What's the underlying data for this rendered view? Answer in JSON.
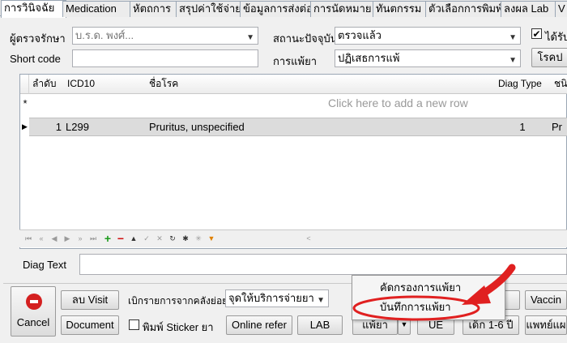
{
  "tabs": [
    "การวินิจฉัย",
    "Medication",
    "หัตถการ",
    "สรุปค่าใช้จ่าย",
    "ข้อมูลการส่งต่อ",
    "การนัดหมาย",
    "ทันตกรรม",
    "ตัวเลือกการพิมพ์",
    "ลงผล Lab",
    "V"
  ],
  "form": {
    "examiner_label": "ผู้ตรวจรักษา",
    "examiner_value": "บ.ร.ด. พงศ์...",
    "status_label": "สถานะปัจจุบัน",
    "status_value": "ตรวจแล้ว",
    "checkbox_label": "ได้รับ",
    "shortcode_label": "Short code",
    "allergy_label": "การแพ้ยา",
    "allergy_value": "ปฏิเสธการแพ้",
    "right_button": "โรคป"
  },
  "grid": {
    "columns": [
      "ลำดับ",
      "ICD10",
      "ชื่อโรค",
      "Diag Type",
      "ชนิ"
    ],
    "new_row_marker": "*",
    "new_row_hint": "Click here to add a new row",
    "rows": [
      {
        "marker": "▶",
        "no": "1",
        "icd10": "L299",
        "name": "Pruritus, unspecified",
        "type": "1",
        "extra": "Pr"
      }
    ]
  },
  "navigator": [
    "first",
    "prev-page",
    "prev",
    "next",
    "next-page",
    "last",
    "add",
    "remove",
    "up",
    "check",
    "cancel",
    "refresh",
    "star",
    "star-new",
    "filter"
  ],
  "diag_text_label": "Diag Text",
  "bottom": {
    "cancel_label": "Cancel",
    "delete_visit": "ลบ Visit",
    "document": "Document",
    "open_list_label": "เบิกรายการจากคลังย่อย",
    "dispense_value": "จุดให้บริการจ่ายยา",
    "print_sticker": "พิมพ์ Sticker ยา",
    "online_refer": "Online refer",
    "lab": "LAB",
    "allergy_button": "แพ้ยา",
    "ue": "UE",
    "child": "เด็ก 1-6 ปี",
    "vaccine": "Vaccin",
    "doctor": "แพทย์แผ"
  },
  "menu": {
    "items": [
      "คัดกรองการแพ้ยา",
      "บันทึกการแพ้ยา"
    ]
  },
  "colors": {
    "highlight": "#e02020",
    "selected_row": "#dcdcdc"
  }
}
